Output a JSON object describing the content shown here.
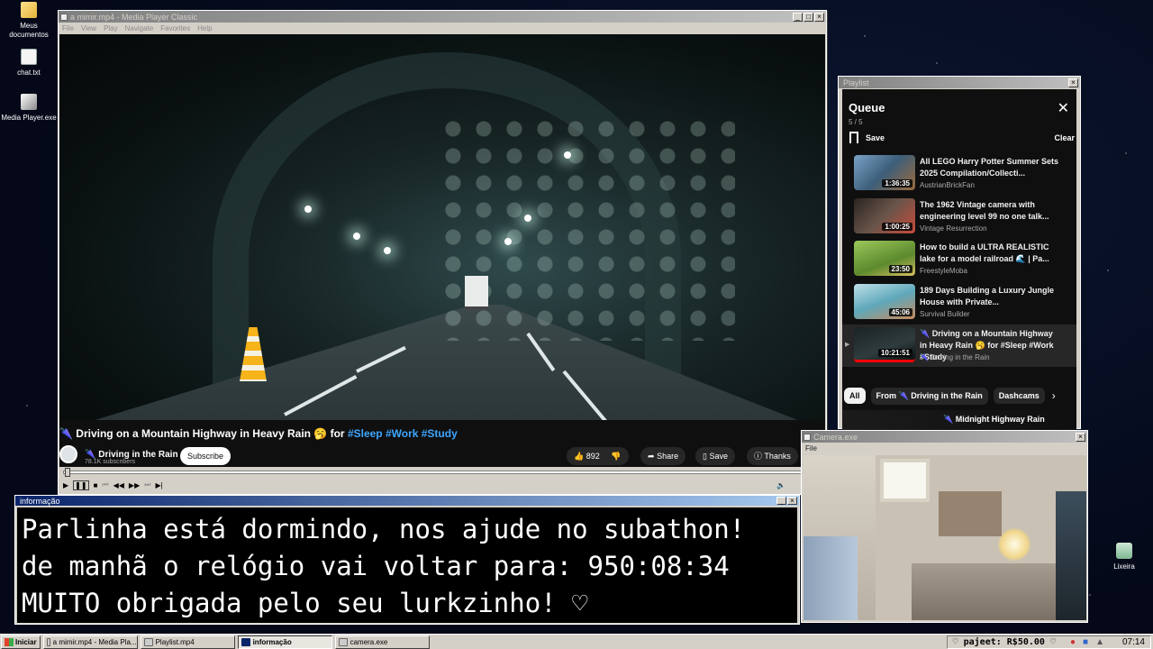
{
  "desktop": {
    "icons": [
      {
        "label": "Meus documentos",
        "icon": "folder-icon"
      },
      {
        "label": "chat.txt",
        "icon": "text-file-icon"
      },
      {
        "label": "Media Player.exe",
        "icon": "media-player-icon"
      },
      {
        "label": "Lixeira",
        "icon": "recycle-bin-icon"
      }
    ]
  },
  "mpc": {
    "title": "a mimir.mp4 - Media Player Classic",
    "menu": [
      "File",
      "View",
      "Play",
      "Navigate",
      "Favorites",
      "Help"
    ]
  },
  "video": {
    "title_prefix": "🌂 Driving on a Mountain Highway in Heavy Rain 🥱 for",
    "hashtags": "#Sleep #Work #Study",
    "channel": "🌂 Driving in the Rain",
    "subscribers": "78.1K subscribers",
    "subscribe_label": "Subscribe",
    "likes": "892",
    "share_label": "Share",
    "save_label": "Save",
    "thanks_label": "Thanks"
  },
  "info_window": {
    "title": "informação",
    "lines": [
      "Parlinha está dormindo, nos ajude no subathon!",
      "de manhã o relógio vai voltar para:  950:08:34",
      "MUITO obrigada pelo seu lurkzinho! ♡"
    ]
  },
  "playlist_window": {
    "title": "Playlist",
    "queue_title": "Queue",
    "count": "5 / 5",
    "save_label": "Save",
    "clear_label": "Clear",
    "items": [
      {
        "title": "All LEGO Harry Potter Summer Sets 2025 Compilation/Collecti...",
        "author": "AustrianBrickFan",
        "duration": "1:36:35",
        "color": "#5a7fa0"
      },
      {
        "title": "The 1962 Vintage camera with engineering level 99 no one talk...",
        "author": "Vintage Resurrection",
        "duration": "1:00:25",
        "color": "#4a3a34"
      },
      {
        "title": "How to build a ULTRA REALISTIC lake for a model railroad 🌊 | Pa...",
        "author": "FreestyleMoba",
        "duration": "23:50",
        "color": "#7fa640"
      },
      {
        "title": "189 Days Building a Luxury Jungle House with Private...",
        "author": "Survival Builder",
        "duration": "45:06",
        "color": "#6fa8b8"
      },
      {
        "title": "🌂 Driving on a Mountain Highway in Heavy Rain 🥱 for #Sleep #Work #Study",
        "author": "🌂 Driving in the Rain",
        "duration": "10:21:51",
        "color": "#1c2426"
      }
    ],
    "chips": [
      "All",
      "From 🌂 Driving in the Rain",
      "Dashcams"
    ],
    "next_up": "🌂 Midnight Highway Rain"
  },
  "camera_window": {
    "title": "Camera.exe",
    "menu": "File"
  },
  "taskbar": {
    "start": "Iniciar",
    "tasks": [
      "a mimir.mp4 - Media Pla...",
      "Playlist.mp4",
      "informação",
      "camera.exe"
    ],
    "user": "♡ pajeet: R$50.00 ♡",
    "clock": "07:14"
  },
  "colors": {
    "titlebar_active": "#0a246a",
    "youtube_dark": "#0f0f0f",
    "hashtag": "#3ea6ff"
  }
}
